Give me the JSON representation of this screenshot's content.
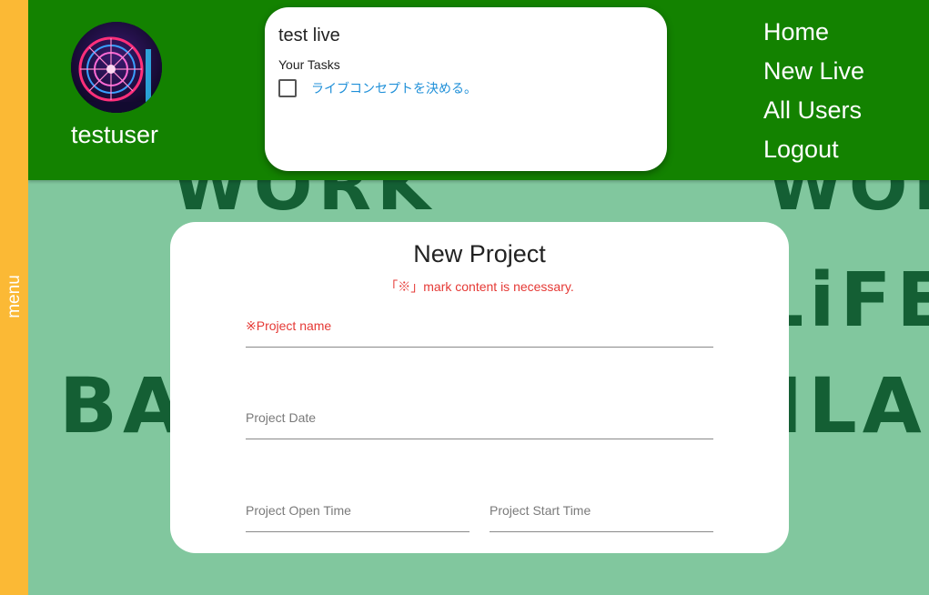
{
  "menu": {
    "label": "menu"
  },
  "profile": {
    "username": "testuser"
  },
  "live_card": {
    "title": "test live",
    "tasks_heading": "Your Tasks",
    "tasks": [
      {
        "label": "ライブコンセプトを決める。",
        "checked": false
      }
    ]
  },
  "nav": {
    "items": [
      "Home",
      "New Live",
      "All Users",
      "Logout"
    ]
  },
  "background_words": [
    "WORK",
    "WORK",
    "LiFE",
    "BA",
    "ILA"
  ],
  "form": {
    "title": "New Project",
    "note": "「※」mark content is necessary.",
    "fields": {
      "name": "※Project name",
      "date": "Project Date",
      "open_time": "Project Open Time",
      "start_time": "Project Start Time"
    }
  },
  "colors": {
    "header": "#138200",
    "menu_rail": "#fbb935",
    "background": "#81c79e",
    "required": "#e53935",
    "link": "#1e8fd8"
  }
}
